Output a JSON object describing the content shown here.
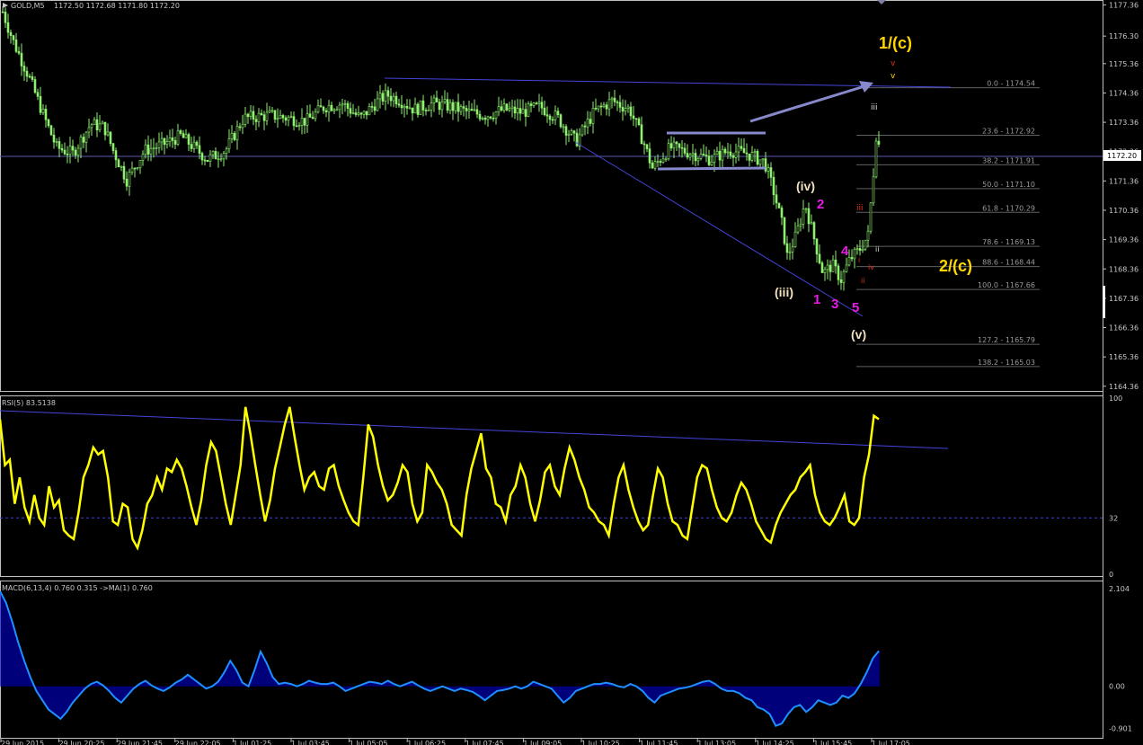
{
  "colors": {
    "background": "#000000",
    "candle": "#8ff070",
    "grid": "#c0c0c0",
    "trendline": "#4444dd",
    "price_line": "#5a5ab0",
    "rsi_line": "#ffff00",
    "macd": "#1e90ff",
    "macd_bars": "#0000cc",
    "wave_magenta": "#e81ce8",
    "wave_yellow": "#ffd700",
    "wave_white": "#f0e0c0",
    "wave_red": "#e03020",
    "arrow": "#8888cc"
  },
  "header": {
    "symbol": "GOLD,M5",
    "ohlc": "1172.50 1172.68 1171.80 1172.20"
  },
  "current_price_label": "1172.20",
  "chart_data": [
    {
      "type": "candlestick",
      "panel": "price",
      "y_ticks": [
        "1177.36",
        "1176.30",
        "1175.36",
        "1174.36",
        "1173.36",
        "1172.36",
        "1171.36",
        "1170.36",
        "1169.36",
        "1168.36",
        "1167.36",
        "1166.36",
        "1165.36",
        "1164.36"
      ],
      "ylim": [
        1164.2,
        1177.5
      ],
      "x_ticks": [
        "29 Jun 2015",
        "29 Jun 20:25",
        "29 Jun 21:45",
        "29 Jun 22:05",
        "1 Jul 01:25",
        "1 Jul 03:45",
        "1 Jul 05:05",
        "1 Jul 06:25",
        "1 Jul 07:45",
        "1 Jul 09:05",
        "1 Jul 10:25",
        "1 Jul 11:45",
        "1 Jul 13:05",
        "1 Jul 14:25",
        "1 Jul 15:45",
        "1 Jul 17:05"
      ],
      "price_path": [
        [
          0,
          1177.3
        ],
        [
          14,
          1176.1
        ],
        [
          30,
          1175.0
        ],
        [
          50,
          1173.4
        ],
        [
          62,
          1172.5
        ],
        [
          80,
          1172.3
        ],
        [
          100,
          1173.3
        ],
        [
          115,
          1173.2
        ],
        [
          125,
          1172.4
        ],
        [
          140,
          1171.4
        ],
        [
          160,
          1172.4
        ],
        [
          180,
          1172.6
        ],
        [
          200,
          1172.9
        ],
        [
          215,
          1172.5
        ],
        [
          230,
          1172.1
        ],
        [
          250,
          1172.4
        ],
        [
          270,
          1173.5
        ],
        [
          300,
          1173.6
        ],
        [
          320,
          1173.5
        ],
        [
          340,
          1173.4
        ],
        [
          360,
          1173.9
        ],
        [
          380,
          1174.0
        ],
        [
          400,
          1173.5
        ],
        [
          420,
          1174.1
        ],
        [
          430,
          1174.3
        ],
        [
          445,
          1174.1
        ],
        [
          460,
          1173.8
        ],
        [
          480,
          1174.0
        ],
        [
          500,
          1173.9
        ],
        [
          520,
          1173.7
        ],
        [
          540,
          1173.6
        ],
        [
          560,
          1173.8
        ],
        [
          580,
          1173.7
        ],
        [
          600,
          1173.9
        ],
        [
          620,
          1173.5
        ],
        [
          640,
          1172.7
        ],
        [
          660,
          1173.7
        ],
        [
          680,
          1174.1
        ],
        [
          700,
          1173.8
        ],
        [
          715,
          1172.7
        ],
        [
          725,
          1171.8
        ],
        [
          745,
          1172.5
        ],
        [
          770,
          1172.3
        ],
        [
          790,
          1172.1
        ],
        [
          810,
          1172.4
        ],
        [
          830,
          1172.3
        ],
        [
          850,
          1172.0
        ],
        [
          860,
          1171.0
        ],
        [
          870,
          1169.8
        ],
        [
          875,
          1168.8
        ],
        [
          885,
          1169.5
        ],
        [
          895,
          1170.6
        ],
        [
          905,
          1169.4
        ],
        [
          915,
          1168.2
        ],
        [
          925,
          1168.5
        ],
        [
          935,
          1168.0
        ],
        [
          945,
          1168.7
        ],
        [
          955,
          1169.0
        ],
        [
          965,
          1169.5
        ],
        [
          972,
          1172.0
        ],
        [
          975,
          1173.4
        ],
        [
          978,
          1172.2
        ]
      ],
      "candle_seed": 7,
      "horizontal_line": 1172.2,
      "fibonacci": [
        {
          "label": "0.0 - 1174.54",
          "price": 1174.54
        },
        {
          "label": "23.6 - 1172.92",
          "price": 1172.92
        },
        {
          "label": "38.2 - 1171.91",
          "price": 1171.91
        },
        {
          "label": "50.0 - 1171.10",
          "price": 1171.1
        },
        {
          "label": "61.8 - 1170.29",
          "price": 1170.29
        },
        {
          "label": "78.6 - 1169.13",
          "price": 1169.13
        },
        {
          "label": "88.6 - 1168.44",
          "price": 1168.44
        },
        {
          "label": "100.0 - 1167.66",
          "price": 1167.66
        },
        {
          "label": "127.2 - 1165.79",
          "price": 1165.79
        },
        {
          "label": "138.2 - 1165.03",
          "price": 1165.03
        }
      ]
    },
    {
      "type": "line",
      "panel": "rsi",
      "name": "RSI(5) 83.5138",
      "y_ticks": [
        "100",
        "32",
        "0"
      ],
      "ylim": [
        0,
        100
      ],
      "level": 32,
      "values": [
        88,
        62,
        65,
        40,
        55,
        38,
        30,
        45,
        32,
        28,
        50,
        38,
        42,
        25,
        22,
        20,
        35,
        55,
        62,
        72,
        68,
        70,
        55,
        30,
        28,
        40,
        38,
        20,
        15,
        25,
        40,
        45,
        55,
        48,
        60,
        58,
        65,
        60,
        50,
        38,
        28,
        42,
        62,
        75,
        70,
        55,
        40,
        28,
        45,
        62,
        95,
        80,
        62,
        45,
        30,
        42,
        60,
        72,
        85,
        95,
        78,
        62,
        48,
        55,
        58,
        50,
        48,
        60,
        62,
        50,
        42,
        35,
        30,
        28,
        55,
        85,
        78,
        62,
        50,
        42,
        45,
        52,
        62,
        58,
        40,
        30,
        35,
        62,
        58,
        52,
        48,
        40,
        28,
        25,
        22,
        45,
        60,
        70,
        80,
        60,
        55,
        40,
        38,
        30,
        45,
        50,
        62,
        55,
        40,
        30,
        42,
        58,
        62,
        50,
        45,
        60,
        72,
        65,
        55,
        48,
        38,
        35,
        30,
        28,
        22,
        40,
        55,
        62,
        48,
        38,
        30,
        25,
        28,
        45,
        60,
        55,
        40,
        30,
        28,
        22,
        20,
        38,
        55,
        62,
        60,
        48,
        38,
        32,
        30,
        35,
        45,
        52,
        48,
        40,
        30,
        25,
        20,
        18,
        28,
        35,
        40,
        45,
        48,
        55,
        58,
        62,
        45,
        35,
        30,
        28,
        32,
        38,
        45,
        30,
        28,
        32,
        55,
        68,
        90,
        88
      ]
    },
    {
      "type": "bar",
      "panel": "macd",
      "name": "MACD(6,13,4) 0.760 0.315 ->MA(1) 0.760",
      "y_ticks": [
        "2.104",
        "0.00",
        "-0.901"
      ],
      "ylim": [
        -1.05,
        2.2
      ],
      "values": [
        2.05,
        1.8,
        1.4,
        0.95,
        0.55,
        0.2,
        -0.1,
        -0.3,
        -0.5,
        -0.6,
        -0.7,
        -0.55,
        -0.35,
        -0.2,
        -0.05,
        0.05,
        0.1,
        0.02,
        -0.1,
        -0.25,
        -0.35,
        -0.2,
        -0.05,
        0.05,
        0.12,
        0.02,
        -0.05,
        -0.1,
        -0.02,
        0.08,
        0.15,
        0.25,
        0.15,
        0.05,
        -0.05,
        0.0,
        0.1,
        0.3,
        0.55,
        0.35,
        0.08,
        0.0,
        0.35,
        0.75,
        0.5,
        0.2,
        0.05,
        0.08,
        0.05,
        0.0,
        0.05,
        0.12,
        0.08,
        0.05,
        0.05,
        0.08,
        0.0,
        -0.1,
        -0.05,
        0.0,
        0.05,
        0.1,
        0.08,
        0.05,
        0.12,
        0.05,
        0.0,
        0.05,
        0.1,
        0.02,
        -0.05,
        -0.1,
        -0.05,
        0.0,
        -0.05,
        -0.1,
        -0.05,
        -0.08,
        -0.12,
        -0.2,
        -0.3,
        -0.2,
        -0.1,
        -0.08,
        -0.05,
        0.0,
        -0.05,
        0.0,
        0.1,
        0.05,
        0.0,
        -0.05,
        -0.2,
        -0.35,
        -0.25,
        -0.1,
        -0.05,
        0.0,
        0.05,
        0.05,
        0.08,
        0.05,
        0.0,
        -0.02,
        0.05,
        0.0,
        -0.1,
        -0.25,
        -0.35,
        -0.2,
        -0.15,
        -0.1,
        -0.05,
        -0.03,
        0.0,
        0.05,
        0.1,
        0.12,
        0.05,
        -0.05,
        -0.1,
        -0.1,
        -0.15,
        -0.25,
        -0.3,
        -0.45,
        -0.5,
        -0.6,
        -0.85,
        -0.8,
        -0.6,
        -0.45,
        -0.4,
        -0.55,
        -0.45,
        -0.3,
        -0.35,
        -0.4,
        -0.35,
        -0.2,
        -0.25,
        -0.15,
        0.05,
        0.3,
        0.6,
        0.76
      ]
    }
  ],
  "waves": {
    "w1c": "1/(c)",
    "w2c": "2/(c)",
    "iv_paren": "(iv)",
    "iii_paren": "(iii)",
    "v_paren": "(v)",
    "m1": "1",
    "m2": "2",
    "m3": "3",
    "m4": "4",
    "m5": "5",
    "r_iii_top": "iii",
    "r_iii": "iii",
    "r_iv": "iv",
    "r_ii": "ii",
    "r_i": "i",
    "r_v": "v",
    "y_v": "v",
    "w_ii": "ii"
  }
}
